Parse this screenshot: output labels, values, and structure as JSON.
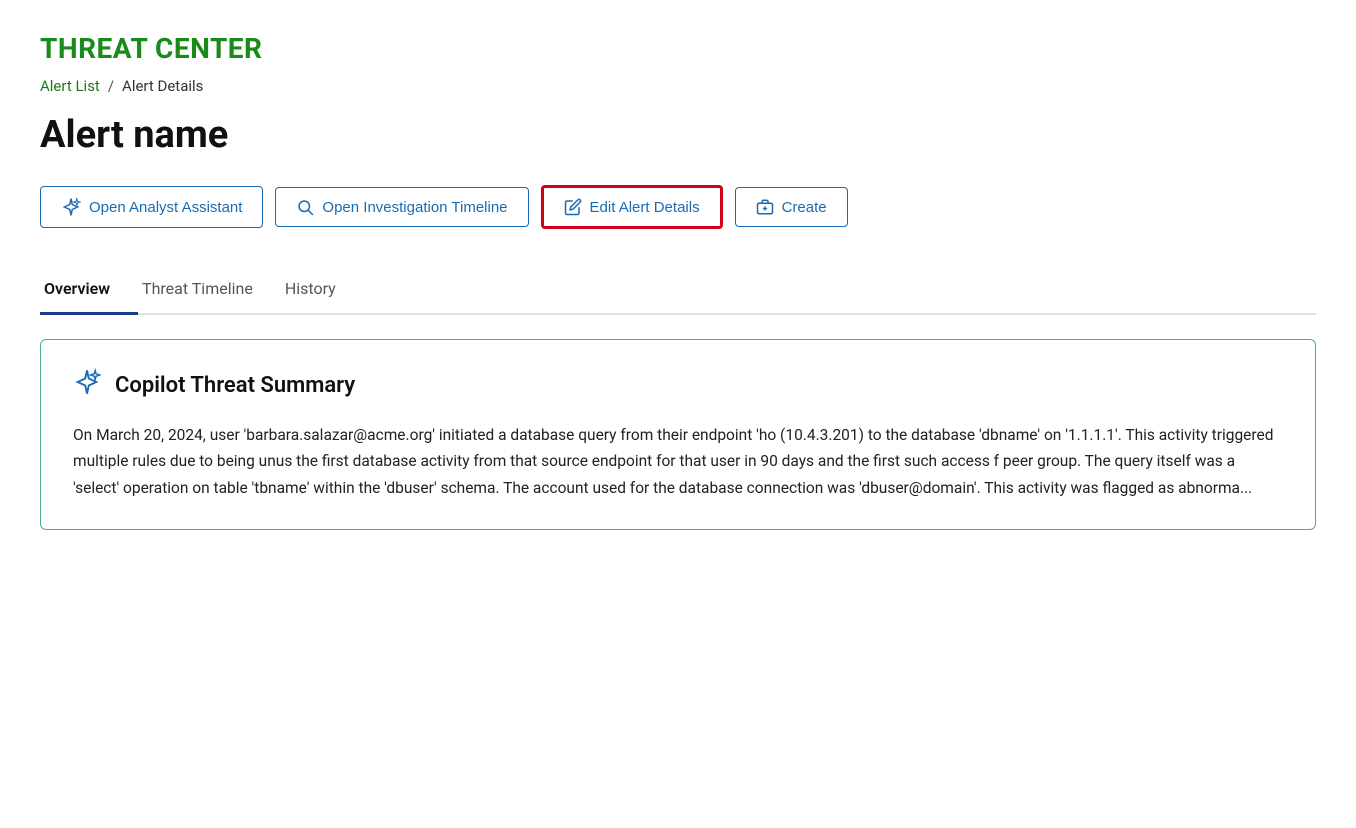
{
  "app": {
    "title": "THREAT CENTER"
  },
  "breadcrumb": {
    "link_label": "Alert List",
    "separator": "/",
    "current": "Alert Details"
  },
  "alert": {
    "name": "Alert name"
  },
  "buttons": [
    {
      "id": "open-analyst-assistant",
      "label": "Open Analyst Assistant",
      "icon": "sparkle",
      "highlighted": false
    },
    {
      "id": "open-investigation-timeline",
      "label": "Open Investigation Timeline",
      "icon": "search",
      "highlighted": false
    },
    {
      "id": "edit-alert-details",
      "label": "Edit Alert Details",
      "icon": "edit",
      "highlighted": true
    },
    {
      "id": "create",
      "label": "Create",
      "icon": "briefcase",
      "highlighted": false
    }
  ],
  "tabs": [
    {
      "id": "overview",
      "label": "Overview",
      "active": true
    },
    {
      "id": "threat-timeline",
      "label": "Threat Timeline",
      "active": false
    },
    {
      "id": "history",
      "label": "History",
      "active": false
    }
  ],
  "copilot_card": {
    "title": "Copilot Threat Summary",
    "body": "On March 20, 2024, user 'barbara.salazar@acme.org' initiated a database query from their endpoint 'ho (10.4.3.201) to the database 'dbname' on '1.1.1.1'. This activity triggered multiple rules due to being unus the first database activity from that source endpoint for that user in 90 days and the first such access f peer group. The query itself was a 'select' operation on table 'tbname' within the 'dbuser' schema. The account used for the database connection was 'dbuser@domain'. This activity was flagged as abnorma..."
  }
}
